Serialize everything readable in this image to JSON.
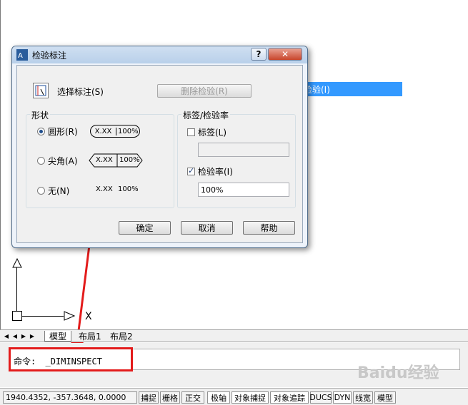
{
  "dialog": {
    "title": "检验标注",
    "help_label": "?",
    "close_label": "✕",
    "select_dimension_label": "选择标注(S)",
    "remove_inspection_label": "删除检验(R)",
    "shape": {
      "group_label": "形状",
      "options": [
        {
          "label": "圆形(R)",
          "preview": "X.XX",
          "rate": "100%",
          "checked": true
        },
        {
          "label": "尖角(A)",
          "preview": "X.XX",
          "rate": "100%",
          "checked": false
        },
        {
          "label": "无(N)",
          "preview": "X.XX",
          "rate": "100%",
          "checked": false
        }
      ]
    },
    "label_rate": {
      "group_label": "标签/检验率",
      "label_checkbox": "标签(L)",
      "label_checked": false,
      "label_value": "",
      "rate_checkbox": "检验率(I)",
      "rate_checked": true,
      "rate_value": "100%"
    },
    "ok_label": "确定",
    "cancel_label": "取消",
    "help_button_label": "帮助"
  },
  "menu_item": {
    "label": "检验(I)",
    "icon": "inspect-icon",
    "bg": "#3399ff"
  },
  "ucs": {
    "x_label": "X"
  },
  "tabs": {
    "items": [
      "模型",
      "布局1",
      "布局2"
    ]
  },
  "command": {
    "prompt": "命令:",
    "value": "_DIMINSPECT"
  },
  "status": {
    "coords": "1940.4352, -357.3648, 0.0000",
    "buttons": [
      "捕捉",
      "栅格",
      "正交",
      "极轴",
      "对象捕捉",
      "对象追踪",
      "DUCS",
      "DYN",
      "线宽",
      "模型"
    ]
  },
  "watermark": "Baidu经验",
  "colors": {
    "accent": "#3399ff",
    "highlight": "#e31b1b"
  }
}
